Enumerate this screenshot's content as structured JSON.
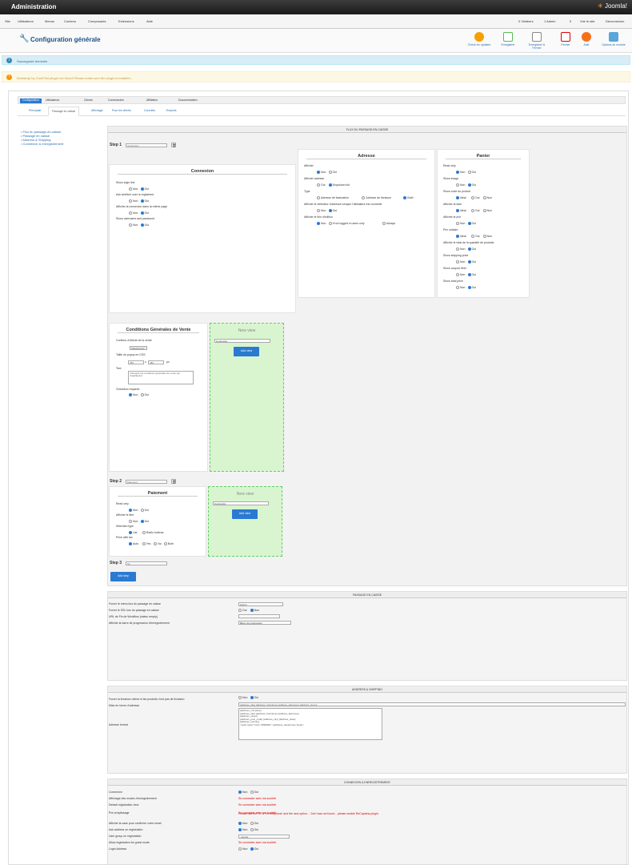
{
  "app": {
    "title": "Administration",
    "logo": "Joomla!"
  },
  "menubar": {
    "items": [
      "Site",
      "Utilisateurs",
      "Menus",
      "Contenu",
      "Composants",
      "Extensions",
      "Aide"
    ],
    "right": [
      "0 Visiteurs",
      "1 Admin",
      "0",
      "Voir le site",
      "Déconnexion"
    ]
  },
  "toolbar": {
    "title": "Configuration générale",
    "buttons": [
      "Check for updates",
      "Enregistrer",
      "Enregistrer & Fermer",
      "Fermer",
      "Aide",
      "Options du module"
    ]
  },
  "info_message": "Sauvegarde terminée",
  "warning_message": "Bootstrap by CoreFirst plugin not found! Please make sure the plugin is enabled...",
  "subbar": {
    "items": [
      "Configuration",
      "Utilisateurs",
      "Clients",
      "Commandes",
      "Affiliation",
      "Documentation"
    ]
  },
  "tabs": [
    "Principale",
    "Passage en caisse",
    "Affichage",
    "Pour les clients",
    "Courriels",
    "Emplois"
  ],
  "sidenav": [
    "Flux du passage-en-caisse",
    "Passage en caisse",
    "Address & Shipping",
    "Connexion & enregistrement"
  ],
  "checkout_flow": {
    "header": "FLUX DU PASSAGE-EN-CAISSE",
    "step1_label": "Step 1",
    "step1_value": "Connexion",
    "step2_label": "Step 2",
    "step2_value": "Paiement",
    "step3_label": "Step 3",
    "step3_value": "No",
    "add_step": "Add step",
    "connexion": {
      "title": "Connexion",
      "fields": [
        {
          "label": "Show login link",
          "opts": [
            "Non",
            "Oui"
          ],
          "sel": 1
        },
        {
          "label": "Ask whether user is registered",
          "opts": [
            "Non",
            "Oui"
          ],
          "sel": 1
        },
        {
          "label": "Afficher la connexion dans la même page",
          "opts": [
            "Non",
            "Oui"
          ],
          "sel": 1
        },
        {
          "label": "Show username and password",
          "opts": [
            "Non",
            "Oui"
          ],
          "sel": 1
        }
      ]
    },
    "adresse": {
      "title": "Adresse",
      "fields": [
        {
          "label": "Afficher",
          "opts": [
            "Non",
            "Oui"
          ],
          "sel": 0
        },
        {
          "label": "Afficher adresse",
          "opts": [
            "Oui",
            "Dropdown list"
          ],
          "sel": 1
        },
        {
          "label": "Type",
          "opts": [
            "Adresse de facturation",
            "Adresse de livraison",
            "Both"
          ],
          "sel": 2
        },
        {
          "label": "Afficher le sélecteur d'adresse lorsque l'utilisateur est connecté",
          "opts": [
            "Non",
            "Oui"
          ],
          "sel": 1
        },
        {
          "label": "Afficher le lien d'édition",
          "opts": [
            "Non",
            "If not logged in users only",
            "Always"
          ],
          "sel": 0
        }
      ]
    },
    "panier": {
      "title": "Panier",
      "fields": [
        {
          "label": "Read only",
          "opts": [
            "Non",
            "Oui"
          ],
          "sel": 0
        },
        {
          "label": "Show image",
          "opts": [
            "Non",
            "Oui"
          ],
          "sel": 1
        },
        {
          "label": "Show code du produit",
          "opts": [
            "Idéal",
            "Oui",
            "Non"
          ],
          "sel": 0
        },
        {
          "label": "Afficher la taxe",
          "opts": [
            "Idéal",
            "Oui",
            "Non"
          ],
          "sel": 0
        },
        {
          "label": "Afficher le prix",
          "opts": [
            "Non",
            "Oui"
          ],
          "sel": 1
        },
        {
          "label": "Prix unitaire",
          "opts": [
            "Idéal",
            "Oui",
            "Non"
          ],
          "sel": 0
        },
        {
          "label": "Afficher le total de la quantité de produits",
          "opts": [
            "Non",
            "Oui"
          ],
          "sel": 1
        },
        {
          "label": "Show shipping price",
          "opts": [
            "Non",
            "Oui"
          ],
          "sel": 1
        },
        {
          "label": "Show coupon field",
          "opts": [
            "Non",
            "Oui"
          ],
          "sel": 1
        },
        {
          "label": "Show total price",
          "opts": [
            "Non",
            "Oui"
          ],
          "sel": 1
        }
      ]
    },
    "cgv": {
      "title": "Conditions Générales de Vente",
      "label1": "Contenu d'Article de la vente",
      "button": "Sélectionner",
      "label2": "Taille du popup en CSS",
      "w": "450",
      "h": "480",
      "px": "px",
      "label3": "Text",
      "text": "J'accepte les conditions générales de vente qui s'appliquent.",
      "label4": "Checkbox required",
      "opts": [
        "Non",
        "Oui"
      ],
      "sel": 0
    },
    "new_view": {
      "title": "New view",
      "select": "Connexion",
      "button": "Add view"
    },
    "paiement": {
      "title": "Paiement",
      "fields": [
        {
          "label": "Read only",
          "opts": [
            "Non",
            "Oui"
          ],
          "sel": 0
        },
        {
          "label": "Afficher le titre",
          "opts": [
            "Non",
            "Oui"
          ],
          "sel": 1
        },
        {
          "label": "Selection type",
          "opts": [
            "List",
            "Radio buttons"
          ],
          "sel": 0
        },
        {
          "label": "Price with tax",
          "opts": [
            "Auto",
            "Yes",
            "No",
            "Both"
          ],
          "sel": 0
        }
      ]
    },
    "new_view2": {
      "title": "New view",
      "select": "Connexion",
      "button": "Add view"
    }
  },
  "passage": {
    "header": "PASSAGE EN CAISSE",
    "rows": [
      {
        "label": "Forcer le menu lors du passage en caisse",
        "type": "select",
        "value": "Aucun"
      },
      {
        "label": "Forcer le SSL lors du passage en caisse",
        "type": "radio",
        "opts": [
          "Oui",
          "Non"
        ],
        "sel": 1
      },
      {
        "label": "URL de Fin de Workflow (valeur empty)",
        "type": "input",
        "value": ""
      },
      {
        "label": "Afficher la barre de progression d'enregistrement",
        "type": "select",
        "value": "Barre de progression"
      }
    ]
  },
  "address_shipping": {
    "header": "ADDRESS & SHIPPING",
    "rows": [
      {
        "label": "Forcer la livraison même si les produits n'ont pas de livraison",
        "opts": [
          "Non",
          "Oui"
        ],
        "sel": 1
      },
      {
        "label": "Mise en forme d'adresse",
        "value": "{address_title} {address_firstname} {address_lastname} {address_street}"
      },
      {
        "label": "Adresse format",
        "value": "{address_company}\n{address_title} {address_firstname} {address_lastname}\n{address_street}\n{address_post_code} {address_city} {address_state}\n{address_country}\n<span style=\"color: #999999;\">{address_telephone}</span>"
      }
    ]
  },
  "connexion_section": {
    "header": "CONNEXION & ENREGISTREMENT",
    "rows": [
      {
        "label": "Connexion",
        "type": "radio",
        "opts": [
          "Non",
          "Oui"
        ],
        "sel": 0
      },
      {
        "label": "Affichage des modes d'enregistrement",
        "type": "red",
        "value": "Se connecter avec ma société"
      },
      {
        "label": "Default registration view",
        "type": "red",
        "value": "Se connecter avec ma société"
      },
      {
        "label": "Pré-remplissage",
        "type": "red",
        "value": "Se connecter avec ma société"
      },
      {
        "label": "Password",
        "type": "red",
        "value": "Please use the '%' or 'Le téléphone' and the new option... 'Join' was not found... please enable ReCaptcha plugin."
      },
      {
        "label": "Afficher la case pour confirmer votre email",
        "type": "radio",
        "opts": [
          "Non",
          "Oui"
        ],
        "sel": 0
      },
      {
        "label": "Ask address on registration",
        "type": "radio",
        "opts": [
          "Non",
          "Oui"
        ],
        "sel": 0
      },
      {
        "label": "User group on registration",
        "type": "select",
        "value": "- Aucun -"
      },
      {
        "label": "Allow registration for guest mode",
        "type": "red",
        "value": "Se connecter avec ma société"
      },
      {
        "label": "Login Address",
        "type": "radio",
        "opts": [
          "Non",
          "Oui"
        ],
        "sel": 1
      }
    ]
  },
  "colors": {
    "accent": "#2a7ad2",
    "link": "#2a6cb0",
    "green_bg": "#d8f5d0",
    "warn": "#c09853",
    "info": "#31708f",
    "error": "#dd0000"
  }
}
